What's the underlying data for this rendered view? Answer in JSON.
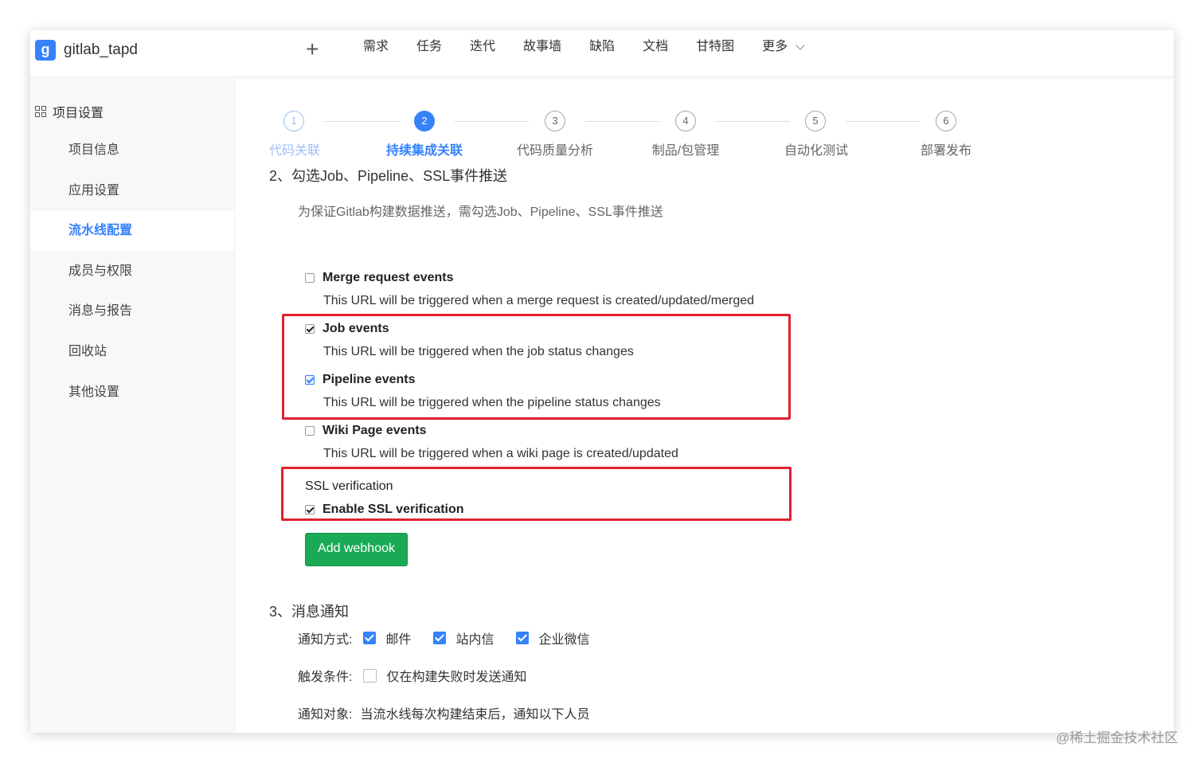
{
  "header": {
    "logo_letter": "g",
    "app_name": "gitlab_tapd",
    "plus_symbol": "+",
    "nav": [
      "需求",
      "任务",
      "迭代",
      "故事墙",
      "缺陷",
      "文档",
      "甘特图"
    ],
    "more": "更多"
  },
  "sidebar": {
    "section": "项目设置",
    "items": [
      {
        "label": "项目信息",
        "active": false
      },
      {
        "label": "应用设置",
        "active": false
      },
      {
        "label": "流水线配置",
        "active": true
      },
      {
        "label": "成员与权限",
        "active": false
      },
      {
        "label": "消息与报告",
        "active": false
      },
      {
        "label": "回收站",
        "active": false
      },
      {
        "label": "其他设置",
        "active": false
      }
    ]
  },
  "steps": [
    {
      "num": "1",
      "label": "代码关联",
      "state": "done"
    },
    {
      "num": "2",
      "label": "持续集成关联",
      "state": "active"
    },
    {
      "num": "3",
      "label": "代码质量分析",
      "state": "todo"
    },
    {
      "num": "4",
      "label": "制品/包管理",
      "state": "todo"
    },
    {
      "num": "5",
      "label": "自动化测试",
      "state": "todo"
    },
    {
      "num": "6",
      "label": "部署发布",
      "state": "todo"
    }
  ],
  "section2": {
    "title": "2、勾选Job、Pipeline、SSL事件推送",
    "hint": "为保证Gitlab构建数据推送，需勾选Job、Pipeline、SSL事件推送",
    "events": [
      {
        "title": "Merge request events",
        "desc": "This URL will be triggered when a merge request is created/updated/merged",
        "checked": false
      },
      {
        "title": "Job events",
        "desc": "This URL will be triggered when the job status changes",
        "checked": true
      },
      {
        "title": "Pipeline events",
        "desc": "This URL will be triggered when the pipeline status changes",
        "checked": true
      },
      {
        "title": "Wiki Page events",
        "desc": "This URL will be triggered when a wiki page is created/updated",
        "checked": false
      }
    ],
    "ssl_label": "SSL verification",
    "ssl_option": "Enable SSL verification",
    "ssl_checked": true,
    "add_button": "Add webhook"
  },
  "section3": {
    "title": "3、消息通知",
    "method_label": "通知方式:",
    "methods": [
      "邮件",
      "站内信",
      "企业微信"
    ],
    "trigger_label": "触发条件:",
    "trigger_option": "仅在构建失败时发送通知",
    "trigger_checked": false,
    "target_label": "通知对象:",
    "target_text": "当流水线每次构建结束后，通知以下人员"
  },
  "colors": {
    "accent": "#3582fb",
    "highlight": "#e0212f",
    "button": "#1aaa55"
  },
  "watermark": "@稀土掘金技术社区"
}
